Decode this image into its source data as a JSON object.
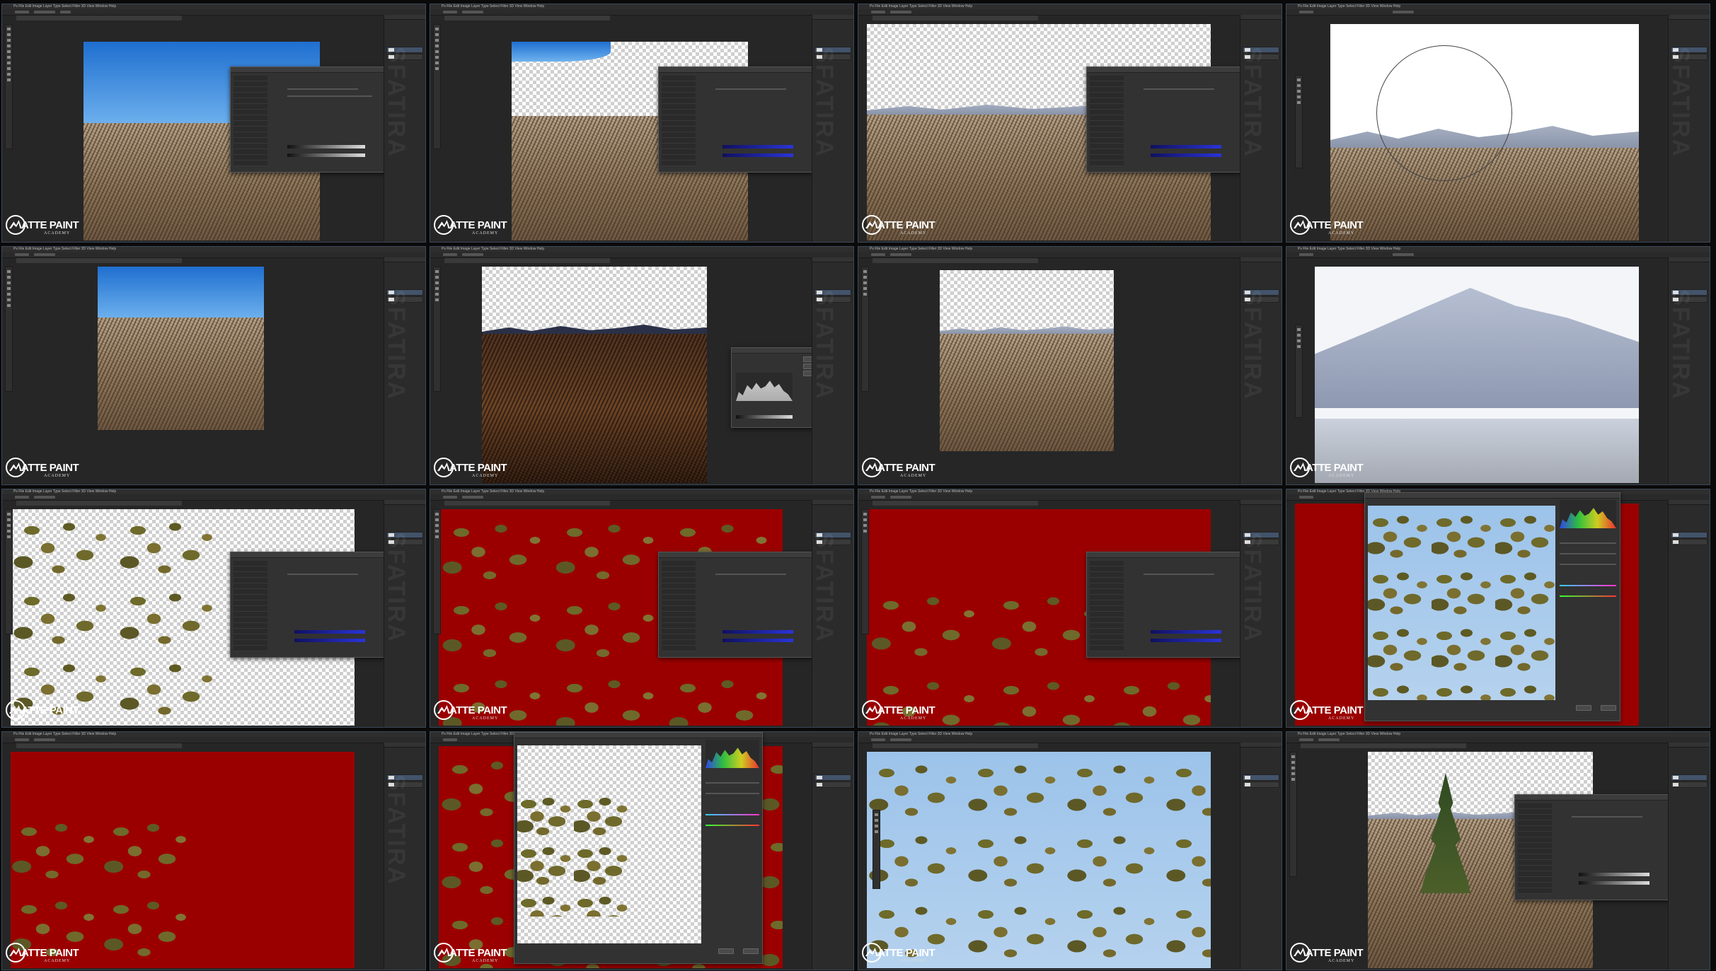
{
  "app": {
    "menu": "Ps  File  Edit  Image  Layer  Type  Select  Filter  3D  View  Window  Help"
  },
  "branding": {
    "logo_title": "ATTE PAINT",
    "logo_sub": "ACADEMY",
    "watermark": "SFATIRA"
  },
  "panels": {
    "layer1": "Layer 1",
    "layer0": "Layer 0"
  }
}
